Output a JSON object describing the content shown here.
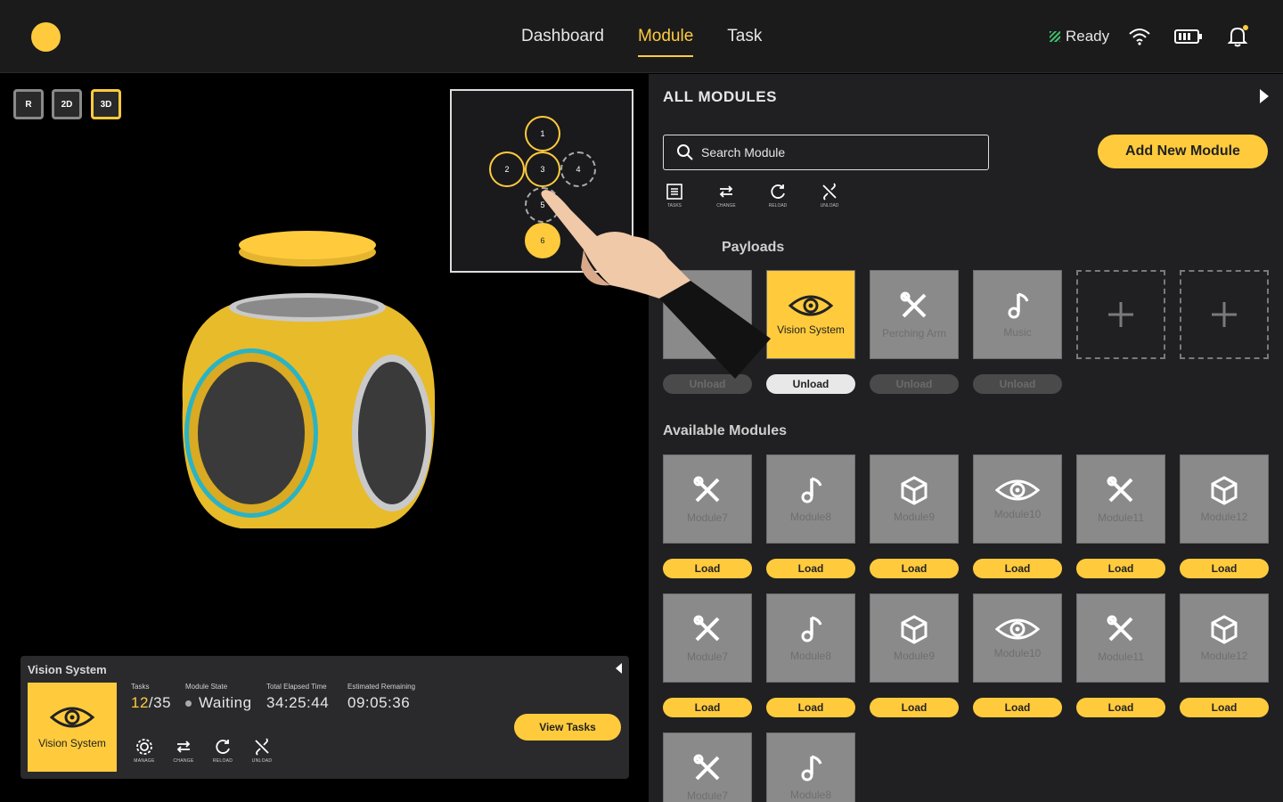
{
  "nav": {
    "items": [
      {
        "label": "Dashboard",
        "active": false
      },
      {
        "label": "Module",
        "active": true
      },
      {
        "label": "Task",
        "active": false
      }
    ]
  },
  "status": {
    "label": "Ready"
  },
  "view_modes": [
    "R",
    "2D",
    "3D"
  ],
  "active_view_mode": "3D",
  "minimap": {
    "nodes": [
      "1",
      "2",
      "3",
      "4",
      "5",
      "6"
    ]
  },
  "info_panel": {
    "title": "Vision System",
    "card_label": "Vision System",
    "tasks_label": "Tasks",
    "tasks_done": "12",
    "tasks_total": "/35",
    "state_label": "Module State",
    "state_value": "Waiting",
    "elapsed_label": "Total Elapsed Time",
    "elapsed_value": "34:25:44",
    "remaining_label": "Estimated Remaining",
    "remaining_value": "09:05:36",
    "actions": [
      "MANAGE",
      "CHANGE",
      "RELOAD",
      "UNLOAD"
    ],
    "view_tasks_label": "View Tasks"
  },
  "right_panel": {
    "title": "ALL MODULES",
    "search_placeholder": "Search Module",
    "add_button": "Add New Module",
    "tools": [
      "TASKS",
      "CHANGE",
      "RELOAD",
      "UNLOAD"
    ],
    "payloads_heading": "Payloads",
    "payloads": [
      {
        "name": "",
        "icon": "hidden",
        "button": "Unload"
      },
      {
        "name": "Vision System",
        "icon": "eye-icon",
        "button": "Unload",
        "active": true
      },
      {
        "name": "Perching Arm",
        "icon": "tools-icon",
        "button": "Unload"
      },
      {
        "name": "Music",
        "icon": "music-icon",
        "button": "Unload"
      }
    ],
    "available_heading": "Available Modules",
    "available": [
      {
        "name": "Module7",
        "icon": "tools-icon",
        "button": "Load"
      },
      {
        "name": "Module8",
        "icon": "music-icon",
        "button": "Load"
      },
      {
        "name": "Module9",
        "icon": "cube-icon",
        "button": "Load"
      },
      {
        "name": "Module10",
        "icon": "eye-icon",
        "button": "Load"
      },
      {
        "name": "Module11",
        "icon": "tools-icon",
        "button": "Load"
      },
      {
        "name": "Module12",
        "icon": "cube-icon",
        "button": "Load"
      },
      {
        "name": "Module7",
        "icon": "tools-icon",
        "button": "Load"
      },
      {
        "name": "Module8",
        "icon": "music-icon",
        "button": "Load"
      },
      {
        "name": "Module9",
        "icon": "cube-icon",
        "button": "Load"
      },
      {
        "name": "Module10",
        "icon": "eye-icon",
        "button": "Load"
      },
      {
        "name": "Module11",
        "icon": "tools-icon",
        "button": "Load"
      },
      {
        "name": "Module12",
        "icon": "cube-icon",
        "button": "Load"
      },
      {
        "name": "Module7",
        "icon": "tools-icon",
        "button": ""
      },
      {
        "name": "Module8",
        "icon": "music-icon",
        "button": ""
      }
    ]
  },
  "colors": {
    "accent": "#ffcb3d",
    "panel": "#202022",
    "tile": "#8a8a8a"
  }
}
